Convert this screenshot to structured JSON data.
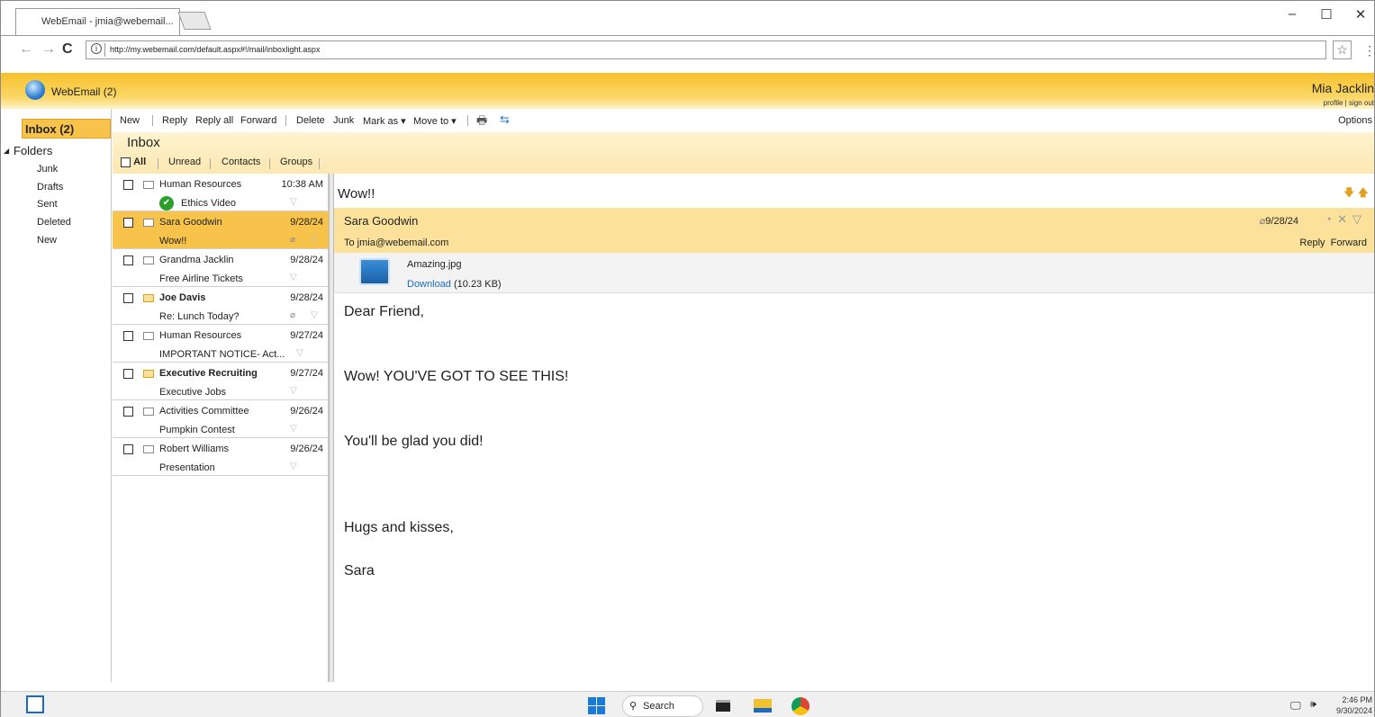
{
  "browser": {
    "tab_title": "WebEmail - jmia@webemail...",
    "url": "http://my.webemail.com/default.aspx#!/mail/inboxlight.aspx",
    "win_min": "–",
    "win_max": "☐",
    "win_close": "✕"
  },
  "app": {
    "name": "WebEmail (2)",
    "user_name": "Mia Jacklin",
    "user_links": "profile | sign out"
  },
  "left": {
    "inbox_label": "Inbox (2)",
    "folders_label": "Folders",
    "folders": [
      "Junk",
      "Drafts",
      "Sent",
      "Deleted",
      "New"
    ]
  },
  "toolbar": {
    "new": "New",
    "reply": "Reply",
    "reply_all": "Reply all",
    "forward": "Forward",
    "delete": "Delete",
    "junk": "Junk",
    "mark_as": "Mark as ▾",
    "move_to": "Move to ▾",
    "options": "Options"
  },
  "inbox": {
    "title": "Inbox",
    "filters": [
      "All",
      "Unread",
      "Contacts",
      "Groups"
    ]
  },
  "messages": [
    {
      "from": "Human Resources",
      "date": "10:38 AM",
      "subject": "Ethics Video",
      "unread": false,
      "selected": false,
      "attachment": false
    },
    {
      "from": "Sara Goodwin",
      "date": "9/28/24",
      "subject": "Wow!!",
      "unread": false,
      "selected": true,
      "attachment": true
    },
    {
      "from": "Grandma Jacklin",
      "date": "9/28/24",
      "subject": "Free Airline Tickets",
      "unread": false,
      "selected": false,
      "attachment": false
    },
    {
      "from": "Joe Davis",
      "date": "9/28/24",
      "subject": "Re: Lunch Today?",
      "unread": true,
      "selected": false,
      "attachment": true
    },
    {
      "from": "Human Resources",
      "date": "9/27/24",
      "subject": "IMPORTANT NOTICE- Act...",
      "unread": false,
      "selected": false,
      "attachment": false
    },
    {
      "from": "Executive Recruiting",
      "date": "9/27/24",
      "subject": "Executive Jobs",
      "unread": true,
      "selected": false,
      "attachment": false
    },
    {
      "from": "Activities Committee",
      "date": "9/26/24",
      "subject": "Pumpkin Contest",
      "unread": false,
      "selected": false,
      "attachment": false
    },
    {
      "from": "Robert Williams",
      "date": "9/26/24",
      "subject": "Presentation",
      "unread": false,
      "selected": false,
      "attachment": false
    }
  ],
  "reading": {
    "subject": "Wow!!",
    "sender": "Sara Goodwin",
    "to": "To jmia@webemail.com",
    "date": "9/28/24",
    "reply": "Reply",
    "forward": "Forward",
    "attachment_name": "Amazing.jpg",
    "download_label": "Download",
    "attachment_size": "(10.23 KB)",
    "body": [
      "Dear Friend,",
      "Wow! YOU'VE GOT TO SEE THIS!",
      "You'll be glad you did!",
      "Hugs and kisses,",
      "Sara"
    ]
  },
  "taskbar": {
    "search": "Search",
    "time": "2:46 PM",
    "date": "9/30/2024"
  }
}
